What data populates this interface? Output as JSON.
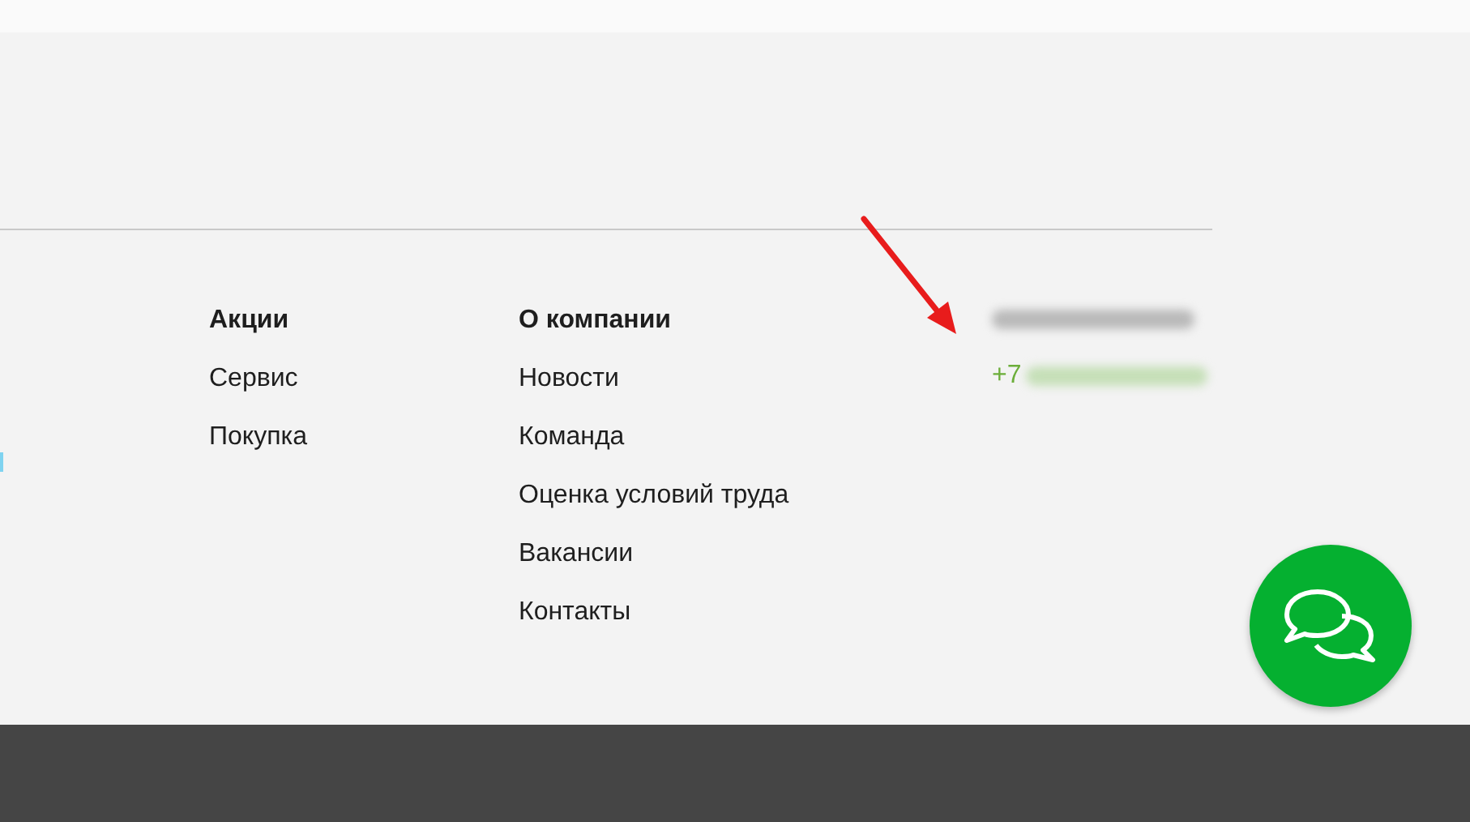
{
  "footer": {
    "columns": [
      {
        "links": [
          {
            "label": "Акции",
            "bold": true
          },
          {
            "label": "Сервис",
            "bold": false
          },
          {
            "label": "Покупка",
            "bold": false
          }
        ]
      },
      {
        "links": [
          {
            "label": "О компании",
            "bold": true
          },
          {
            "label": "Новости",
            "bold": false
          },
          {
            "label": "Команда",
            "bold": false
          },
          {
            "label": "Оценка условий труда",
            "bold": false
          },
          {
            "label": "Вакансии",
            "bold": false
          },
          {
            "label": "Контакты",
            "bold": false
          }
        ]
      }
    ],
    "contact": {
      "phone_prefix": "+7"
    }
  }
}
